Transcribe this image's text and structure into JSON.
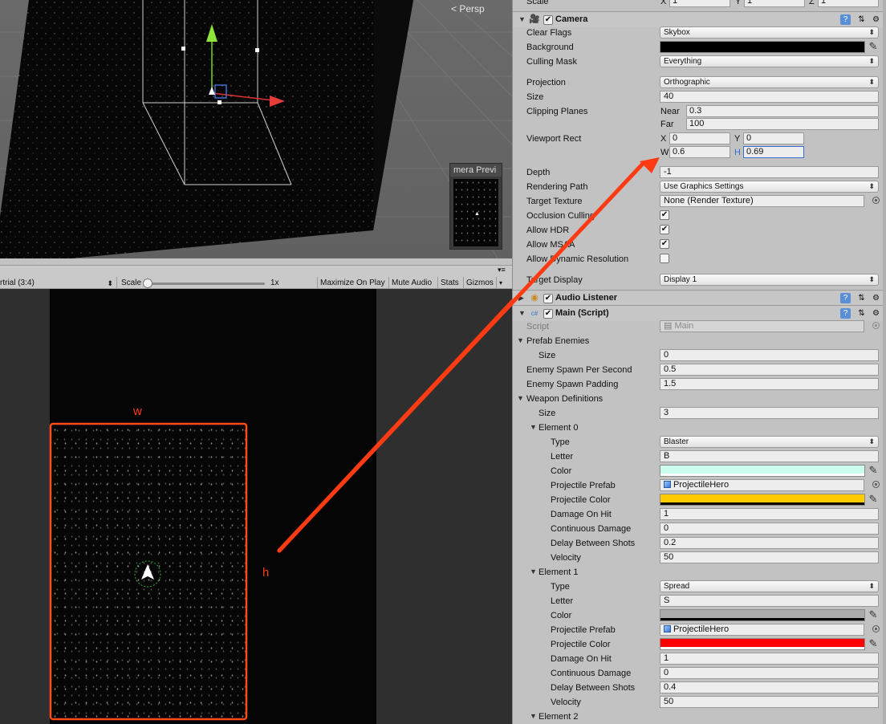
{
  "scene": {
    "persp_label": "Persp",
    "camera_preview_title": "mera Previ"
  },
  "game_toolbar": {
    "aspect": "rtrial (3:4)",
    "scale_label": "Scale",
    "scale_value": "1x",
    "maximize": "Maximize On Play",
    "mute": "Mute Audio",
    "stats": "Stats",
    "gizmos": "Gizmos"
  },
  "annotations": {
    "w": "w",
    "h": "h"
  },
  "colors": {
    "arrow": "#ff3b14",
    "weapon0_color": "#ccfff0",
    "weapon0_projectile_color": "#ffcc00",
    "weapon1_color": "#aaaaaa",
    "weapon1_projectile_color": "#ff0000",
    "background": "#000000"
  },
  "inspector": {
    "transform_scale": {
      "label": "Scale",
      "x_label": "X",
      "x": "1",
      "y_label": "Y",
      "y": "1",
      "z_label": "Z",
      "z": "1"
    },
    "camera": {
      "title": "Camera",
      "clear_flags": {
        "label": "Clear Flags",
        "value": "Skybox"
      },
      "background": {
        "label": "Background"
      },
      "culling_mask": {
        "label": "Culling Mask",
        "value": "Everything"
      },
      "projection": {
        "label": "Projection",
        "value": "Orthographic"
      },
      "size": {
        "label": "Size",
        "value": "40"
      },
      "clipping_planes": {
        "label": "Clipping Planes",
        "near_label": "Near",
        "near": "0.3",
        "far_label": "Far",
        "far": "100"
      },
      "viewport_rect": {
        "label": "Viewport Rect",
        "x_label": "X",
        "x": "0",
        "y_label": "Y",
        "y": "0",
        "w_label": "W",
        "w": "0.6",
        "h_label": "H",
        "h": "0.69"
      },
      "depth": {
        "label": "Depth",
        "value": "-1"
      },
      "rendering_path": {
        "label": "Rendering Path",
        "value": "Use Graphics Settings"
      },
      "target_texture": {
        "label": "Target Texture",
        "value": "None (Render Texture)"
      },
      "occlusion_culling": {
        "label": "Occlusion Culling",
        "checked": true
      },
      "allow_hdr": {
        "label": "Allow HDR",
        "checked": true
      },
      "allow_msaa": {
        "label": "Allow MSAA",
        "checked": true
      },
      "allow_dynamic_resolution": {
        "label": "Allow Dynamic Resolution",
        "checked": false
      },
      "target_display": {
        "label": "Target Display",
        "value": "Display 1"
      }
    },
    "audio_listener": {
      "title": "Audio Listener"
    },
    "main_script": {
      "title": "Main (Script)",
      "script": {
        "label": "Script",
        "value": "Main"
      },
      "prefab_enemies": {
        "label": "Prefab Enemies",
        "size_label": "Size",
        "size": "0"
      },
      "enemy_spawn_per_second": {
        "label": "Enemy Spawn Per Second",
        "value": "0.5"
      },
      "enemy_spawn_padding": {
        "label": "Enemy Spawn Padding",
        "value": "1.5"
      },
      "weapon_definitions": {
        "label": "Weapon Definitions",
        "size_label": "Size",
        "size": "3",
        "elements": [
          {
            "title": "Element 0",
            "type_label": "Type",
            "type": "Blaster",
            "letter_label": "Letter",
            "letter": "B",
            "color_label": "Color",
            "projectile_prefab_label": "Projectile Prefab",
            "projectile_prefab": "ProjectileHero",
            "projectile_color_label": "Projectile Color",
            "damage_on_hit_label": "Damage On Hit",
            "damage_on_hit": "1",
            "continuous_damage_label": "Continuous Damage",
            "continuous_damage": "0",
            "delay_between_shots_label": "Delay Between Shots",
            "delay_between_shots": "0.2",
            "velocity_label": "Velocity",
            "velocity": "50"
          },
          {
            "title": "Element 1",
            "type_label": "Type",
            "type": "Spread",
            "letter_label": "Letter",
            "letter": "S",
            "color_label": "Color",
            "projectile_prefab_label": "Projectile Prefab",
            "projectile_prefab": "ProjectileHero",
            "projectile_color_label": "Projectile Color",
            "damage_on_hit_label": "Damage On Hit",
            "damage_on_hit": "1",
            "continuous_damage_label": "Continuous Damage",
            "continuous_damage": "0",
            "delay_between_shots_label": "Delay Between Shots",
            "delay_between_shots": "0.4",
            "velocity_label": "Velocity",
            "velocity": "50"
          },
          {
            "title": "Element 2"
          }
        ]
      }
    }
  }
}
